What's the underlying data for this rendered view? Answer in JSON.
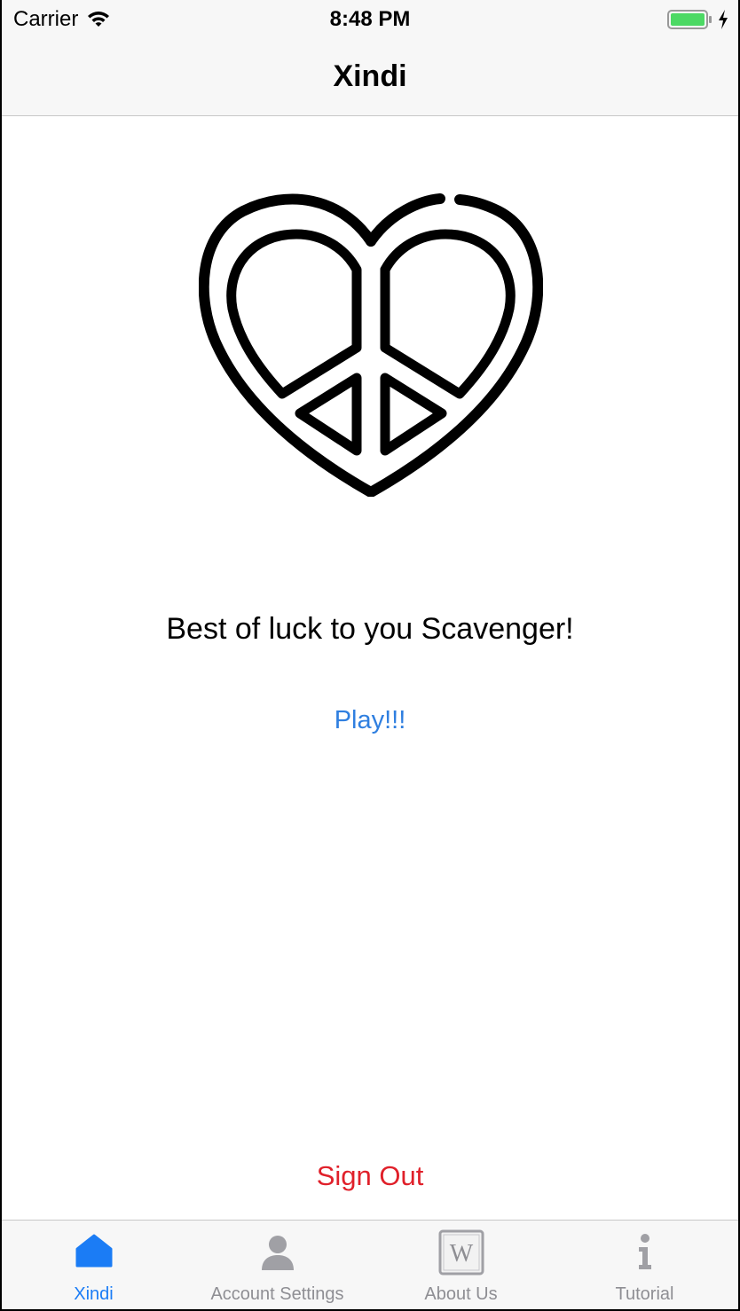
{
  "status_bar": {
    "carrier": "Carrier",
    "time": "8:48 PM",
    "battery_color": "#4cd964"
  },
  "nav": {
    "title": "Xindi"
  },
  "main": {
    "logo_icon": "heart-peace-icon",
    "greeting": "Best of luck to you Scavenger!",
    "play_label": "Play!!!",
    "signout_label": "Sign Out"
  },
  "tabs": [
    {
      "label": "Xindi",
      "icon": "home-icon",
      "active": true
    },
    {
      "label": "Account Settings",
      "icon": "person-icon",
      "active": false
    },
    {
      "label": "About Us",
      "icon": "wikipedia-icon",
      "active": false
    },
    {
      "label": "Tutorial",
      "icon": "info-icon",
      "active": false
    }
  ],
  "colors": {
    "accent": "#1b7cf5",
    "link": "#2f7fe0",
    "destructive": "#e0202a",
    "inactive": "#8e8e93"
  }
}
